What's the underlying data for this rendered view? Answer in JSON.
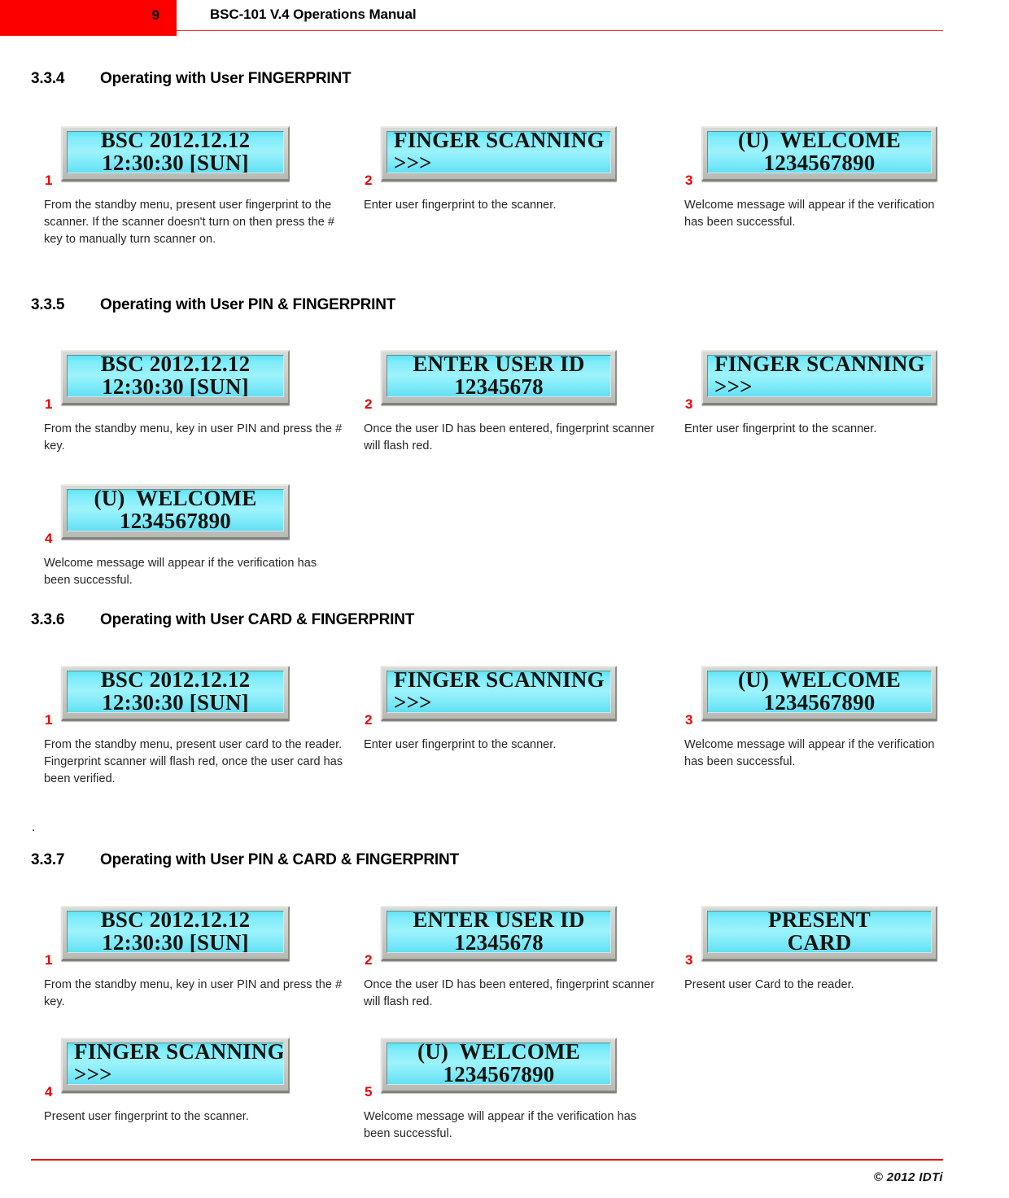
{
  "header": {
    "page_number": "9",
    "title": "BSC-101 V.4 Operations Manual"
  },
  "footer": {
    "copyright": "© 2012 IDTi"
  },
  "stray_period": ".",
  "sections": [
    {
      "number": "3.3.4",
      "title": "Operating with User FINGERPRINT",
      "steps": [
        {
          "num": "1",
          "lcd": {
            "line1": "BSC 2012.12.12",
            "line2": "12:30:30 [SUN]",
            "align": "center"
          },
          "caption": "From the standby menu, present user fingerprint to the scanner. If the scanner doesn't turn on then press the # key to manually turn scanner on."
        },
        {
          "num": "2",
          "lcd": {
            "line1": "FINGER SCANNING",
            "line2": ">>>",
            "align": "left"
          },
          "caption": "Enter user fingerprint to the scanner."
        },
        {
          "num": "3",
          "lcd": {
            "line1": "(U)  WELCOME",
            "line2": "1234567890",
            "align": "center"
          },
          "caption": "Welcome message will appear if the verification has been successful."
        }
      ]
    },
    {
      "number": "3.3.5",
      "title": "Operating with User PIN & FINGERPRINT",
      "steps": [
        {
          "num": "1",
          "lcd": {
            "line1": "BSC 2012.12.12",
            "line2": "12:30:30 [SUN]",
            "align": "center"
          },
          "caption": "From the standby menu, key in user PIN and press the # key."
        },
        {
          "num": "2",
          "lcd": {
            "line1": "ENTER USER ID",
            "line2": "12345678",
            "align": "center"
          },
          "caption": "Once the user ID has been entered, fingerprint scanner will flash red."
        },
        {
          "num": "3",
          "lcd": {
            "line1": "FINGER SCANNING",
            "line2": ">>>",
            "align": "left"
          },
          "caption": "Enter user fingerprint to the scanner."
        },
        {
          "num": "4",
          "lcd": {
            "line1": "(U)  WELCOME",
            "line2": "1234567890",
            "align": "center"
          },
          "caption": "Welcome message will appear if the verification has been successful."
        }
      ]
    },
    {
      "number": "3.3.6",
      "title": "Operating with User CARD & FINGERPRINT",
      "steps": [
        {
          "num": "1",
          "lcd": {
            "line1": "BSC 2012.12.12",
            "line2": "12:30:30 [SUN]",
            "align": "center"
          },
          "caption": "From the standby menu, present user card to the reader. Fingerprint scanner will flash red, once the user card has been verified."
        },
        {
          "num": "2",
          "lcd": {
            "line1": "FINGER SCANNING",
            "line2": ">>>",
            "align": "left"
          },
          "caption": "Enter user fingerprint to the scanner."
        },
        {
          "num": "3",
          "lcd": {
            "line1": "(U)  WELCOME",
            "line2": "1234567890",
            "align": "center"
          },
          "caption": "Welcome message will appear if the verification has been successful."
        }
      ]
    },
    {
      "number": "3.3.7",
      "title": "Operating with User PIN & CARD & FINGERPRINT",
      "steps": [
        {
          "num": "1",
          "lcd": {
            "line1": "BSC 2012.12.12",
            "line2": "12:30:30 [SUN]",
            "align": "center"
          },
          "caption": "From the standby menu, key in user PIN and press the # key."
        },
        {
          "num": "2",
          "lcd": {
            "line1": "ENTER USER ID",
            "line2": "12345678",
            "align": "center"
          },
          "caption": "Once the user ID has been entered, fingerprint scanner will flash red."
        },
        {
          "num": "3",
          "lcd": {
            "line1": "PRESENT",
            "line2": "CARD",
            "align": "center"
          },
          "caption": "Present user Card to the reader."
        },
        {
          "num": "4",
          "lcd": {
            "line1": "FINGER SCANNING",
            "line2": ">>>",
            "align": "left"
          },
          "caption": "Present user fingerprint to the scanner."
        },
        {
          "num": "5",
          "lcd": {
            "line1": "(U)  WELCOME",
            "line2": "1234567890",
            "align": "center"
          },
          "caption": "Welcome message will appear if the verification has been successful."
        }
      ]
    }
  ],
  "colors": {
    "header_red": "#fc0000",
    "rule_red": "#f10c0c",
    "step_number_red": "#ee0000",
    "lcd_screen_cyan": "#7fecfa",
    "lcd_text": "#121410",
    "lcd_bezel": "#cfcfca"
  }
}
